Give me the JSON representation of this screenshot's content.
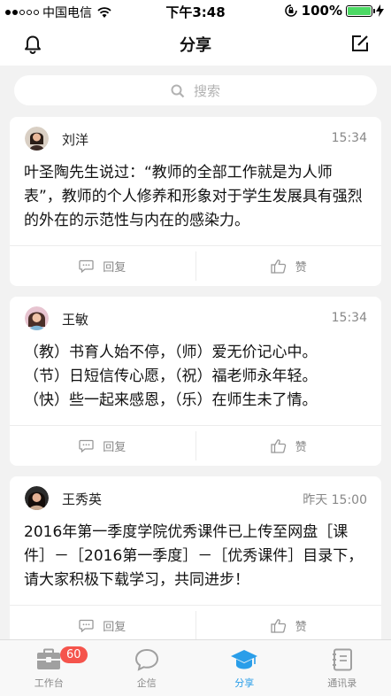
{
  "status_bar": {
    "carrier": "中国电信",
    "time": "下午3:48",
    "battery": "100%"
  },
  "nav": {
    "title": "分享"
  },
  "search": {
    "placeholder": "搜索"
  },
  "posts": [
    {
      "name": "刘洋",
      "time": "15:34",
      "text": "叶圣陶先生说过：“教师的全部工作就是为人师表”，教师的个人修养和形象对于学生发展具有强烈的外在的示范性与内在的感染力。",
      "reply_label": "回复",
      "like_label": "赞"
    },
    {
      "name": "王敏",
      "time": "15:34",
      "lines": [
        "（教）书育人始不停，（师）爱无价记心中。",
        "（节）日短信传心愿，（祝）福老师永年轻。",
        "（快）些一起来感恩，（乐）在师生未了情。"
      ],
      "reply_label": "回复",
      "like_label": "赞"
    },
    {
      "name": "王秀英",
      "time": "昨天 15:00",
      "text": "2016年第一季度学院优秀课件已上传至网盘［课件］－［2016第一季度］－［优秀课件］目录下，请大家积极下载学习，共同进步！",
      "reply_label": "回复",
      "like_label": "赞"
    }
  ],
  "tabs": [
    {
      "label": "工作台",
      "badge": "60"
    },
    {
      "label": "企信"
    },
    {
      "label": "分享",
      "active": true
    },
    {
      "label": "通讯录"
    }
  ],
  "colors": {
    "accent": "#2a9ee9",
    "badge": "#f5544c",
    "battery": "#4cd964"
  }
}
